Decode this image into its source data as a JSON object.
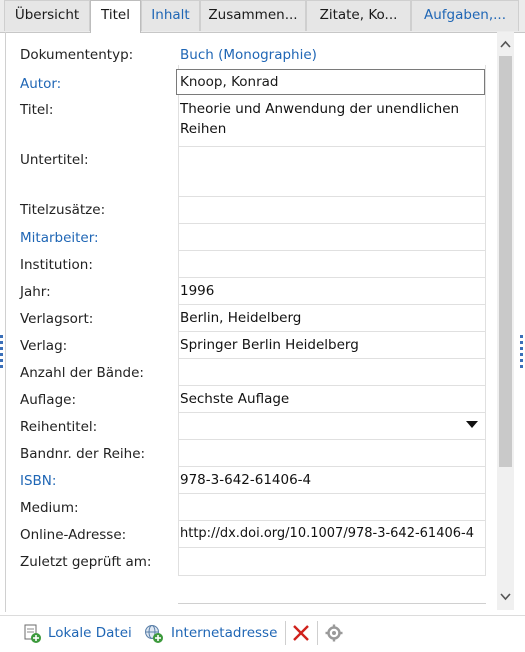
{
  "tabs": [
    {
      "label": "Übersicht",
      "active": false,
      "link": false
    },
    {
      "label": "Titel",
      "active": true,
      "link": false
    },
    {
      "label": "Inhalt",
      "active": false,
      "link": true
    },
    {
      "label": "Zusammen...",
      "active": false,
      "link": false
    },
    {
      "label": "Zitate, Ko...",
      "active": false,
      "link": false
    },
    {
      "label": "Aufgaben,...",
      "active": false,
      "link": true
    }
  ],
  "fields": {
    "doctype_label": "Dokumententyp:",
    "doctype_value": "Buch (Monographie)",
    "author_label": "Autor:",
    "author_value": "Knoop, Konrad",
    "title_label": "Titel:",
    "title_line1": "Theorie und Anwendung der unendlichen",
    "title_line2": "Reihen",
    "subtitle_label": "Untertitel:",
    "titleadd_label": "Titelzusätze:",
    "contributors_label": "Mitarbeiter:",
    "institution_label": "Institution:",
    "year_label": "Jahr:",
    "year_value": "1996",
    "place_label": "Verlagsort:",
    "place_value": "Berlin, Heidelberg",
    "publisher_label": "Verlag:",
    "publisher_value": "Springer Berlin Heidelberg",
    "volumes_label": "Anzahl der Bände:",
    "edition_label": "Auflage:",
    "edition_value": "Sechste Auflage",
    "series_label": "Reihentitel:",
    "seriesno_label": "Bandnr. der Reihe:",
    "isbn_label": "ISBN:",
    "isbn_value": "978-3-642-61406-4",
    "medium_label": "Medium:",
    "url_label": "Online-Adresse:",
    "url_value": "http://dx.doi.org/10.1007/978-3-642-61406-4",
    "lastchecked_label": "Zuletzt geprüft am:"
  },
  "toolbar": {
    "local_file": "Lokale Datei",
    "web_address": "Internetadresse"
  },
  "colors": {
    "link": "#1f66b5",
    "delete": "#d0211c"
  }
}
